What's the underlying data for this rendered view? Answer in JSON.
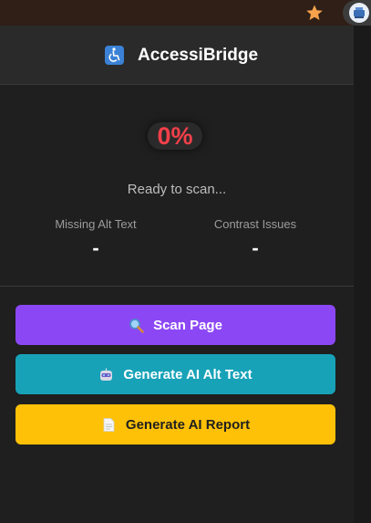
{
  "browser": {
    "star_icon": "star-icon",
    "extension_icon": "accessibridge-extension-icon"
  },
  "header": {
    "logo_icon": "wheelchair-icon",
    "title": "AccessiBridge"
  },
  "scan": {
    "percent": "0%",
    "status": "Ready to scan..."
  },
  "stats": {
    "missing_alt_label": "Missing Alt Text",
    "missing_alt_value": "-",
    "contrast_label": "Contrast Issues",
    "contrast_value": "-"
  },
  "buttons": {
    "scan_label": "Scan Page",
    "scan_icon": "magnifier-icon",
    "alt_label": "Generate AI Alt Text",
    "alt_icon": "robot-icon",
    "report_label": "Generate AI Report",
    "report_icon": "document-icon"
  },
  "colors": {
    "accent_purple": "#8c47f5",
    "accent_teal": "#17a2b8",
    "accent_yellow": "#ffc107",
    "percent_red": "#f2404a",
    "background": "#1f1f1f"
  }
}
